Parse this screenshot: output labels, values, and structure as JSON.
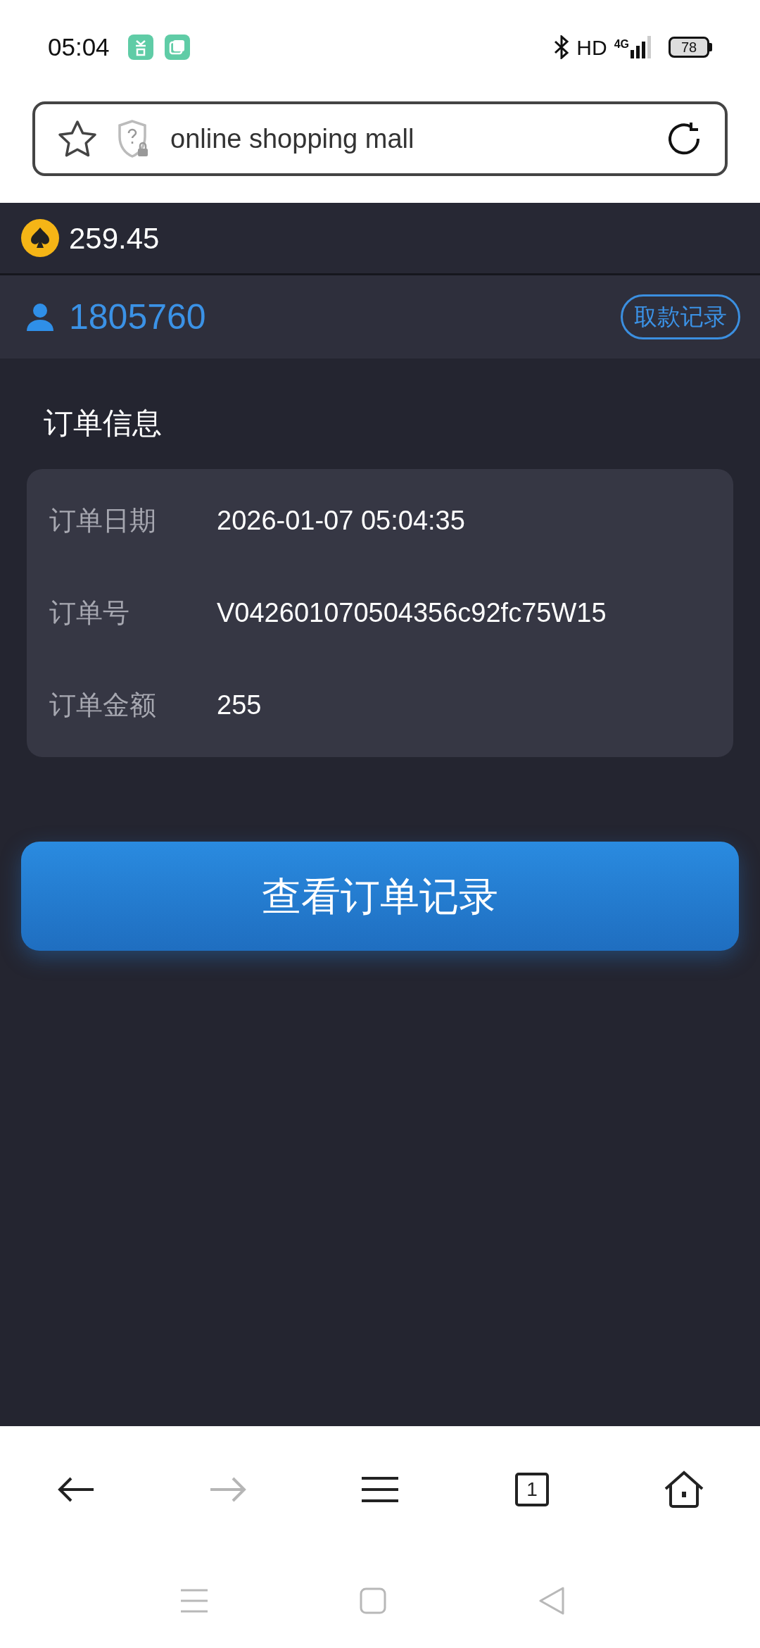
{
  "status_bar": {
    "time": "05:04",
    "network": "HD",
    "signal_type": "4G",
    "battery": "78"
  },
  "address_bar": {
    "text": "online shopping mall"
  },
  "balance": {
    "amount": "259.45"
  },
  "user": {
    "id": "1805760",
    "action": "取款记录"
  },
  "order": {
    "title": "订单信息",
    "rows": [
      {
        "label": "订单日期",
        "value": "2026-01-07 05:04:35"
      },
      {
        "label": "订单号",
        "value": "V042601070504356c92fc75W15"
      },
      {
        "label": "订单金额",
        "value": "255"
      }
    ]
  },
  "primary_button": "查看订单记录",
  "browser_nav": [
    {
      "kind": "back",
      "disabled": false
    },
    {
      "kind": "forward",
      "disabled": true
    },
    {
      "kind": "menu",
      "disabled": false
    },
    {
      "kind": "tabs",
      "disabled": false,
      "count": "1"
    },
    {
      "kind": "home",
      "disabled": false
    }
  ]
}
